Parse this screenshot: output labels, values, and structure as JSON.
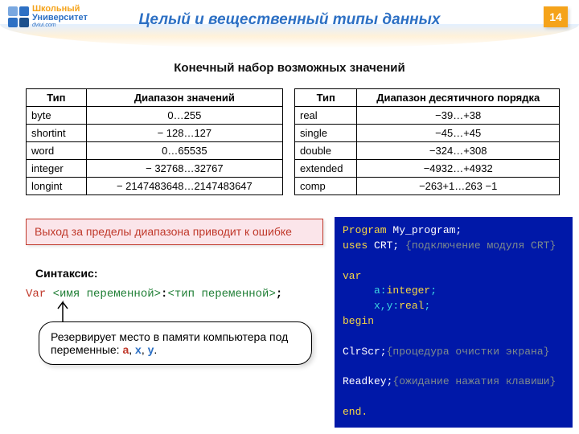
{
  "page_number": "14",
  "logo": {
    "line1": "Школьный",
    "line2": "Университет",
    "sub": "dviui.com"
  },
  "title": "Целый и вещественный типы данных",
  "subtitle": "Конечный набор возможных значений",
  "table_int": {
    "h1": "Тип",
    "h2": "Диапазон значений",
    "rows": [
      {
        "t": "byte",
        "r": "0…255"
      },
      {
        "t": "shortint",
        "r": "− 128…127"
      },
      {
        "t": "word",
        "r": "0…65535"
      },
      {
        "t": "integer",
        "r": "− 32768…32767"
      },
      {
        "t": "longint",
        "r": "− 2147483648…2147483647"
      }
    ]
  },
  "table_real": {
    "h1": "Тип",
    "h2": "Диапазон десятичного порядка",
    "rows": [
      {
        "t": "real",
        "r": "−39…+38"
      },
      {
        "t": "single",
        "r": "−45…+45"
      },
      {
        "t": "double",
        "r": "−324…+308"
      },
      {
        "t": "extended",
        "r": "−4932…+4932"
      },
      {
        "t": "comp",
        "r": "−263+1…263 −1"
      }
    ]
  },
  "warning": "Выход за пределы диапазона приводит к ошибке",
  "syntax_label": "Синтаксис:",
  "syntax": {
    "var": "Var ",
    "name_ph": "<имя переменной>",
    "colon": ":",
    "type_ph": "<тип переменной>",
    "semi": ";"
  },
  "callout": {
    "pre": "Резервирует  место в памяти компьютера под переменные:  ",
    "a": "а",
    "sep1": ", ",
    "x": "х",
    "sep2": ", ",
    "y": "у",
    "dot": "."
  },
  "code": {
    "l1a": "Program ",
    "l1b": "My_program;",
    "l2a": "uses ",
    "l2b": "CRT; ",
    "l2c": "{подключение модуля CRT}",
    "l3": "var",
    "l4a": "     a:",
    "l4b": "integer",
    "l4c": ";",
    "l5a": "     x,y:",
    "l5b": "real",
    "l5c": ";",
    "l6": "begin",
    "l7a": "ClrScr;",
    "l7b": "{процедура очистки экрана}",
    "l8a": "Readkey;",
    "l8b": "{ожидание нажатия клавиши}",
    "l9": "end."
  }
}
